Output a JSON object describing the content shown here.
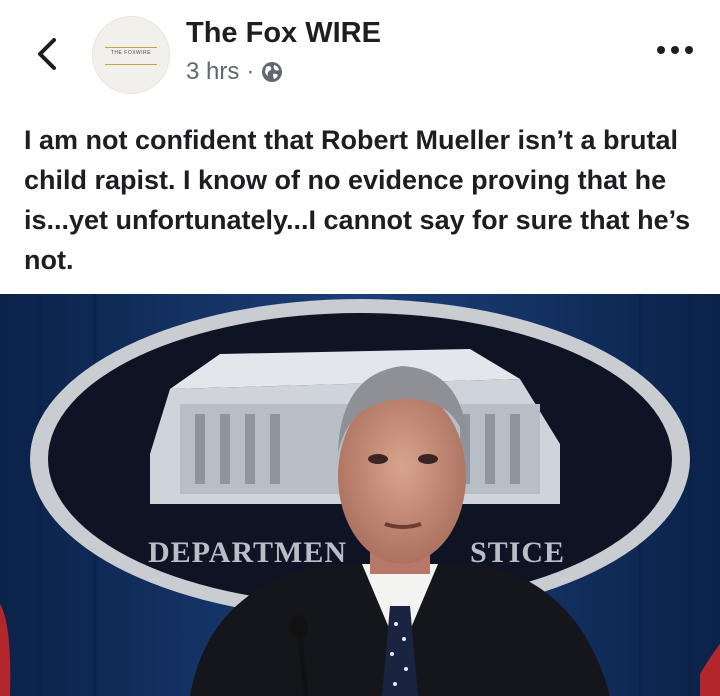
{
  "post": {
    "page_name": "The Fox WIRE",
    "avatar_text": "THE FOXWIRE",
    "timestamp": "3 hrs",
    "separator": "·",
    "privacy_icon": "globe-icon",
    "body": "I am not confident that Robert Mueller isn’t a brutal child rapist. I know of no evidence proving that he is...yet unfortunately...I cannot say for sure that he’s not."
  },
  "photo": {
    "sign_left": "DEPARTMEN",
    "sign_right": "STICE"
  },
  "icons": {
    "back": "chevron-left-icon",
    "more": "more-options-icon"
  },
  "colors": {
    "text_primary": "#1c1e21",
    "text_secondary": "#606770",
    "backdrop_blue": "#0f2a55"
  }
}
